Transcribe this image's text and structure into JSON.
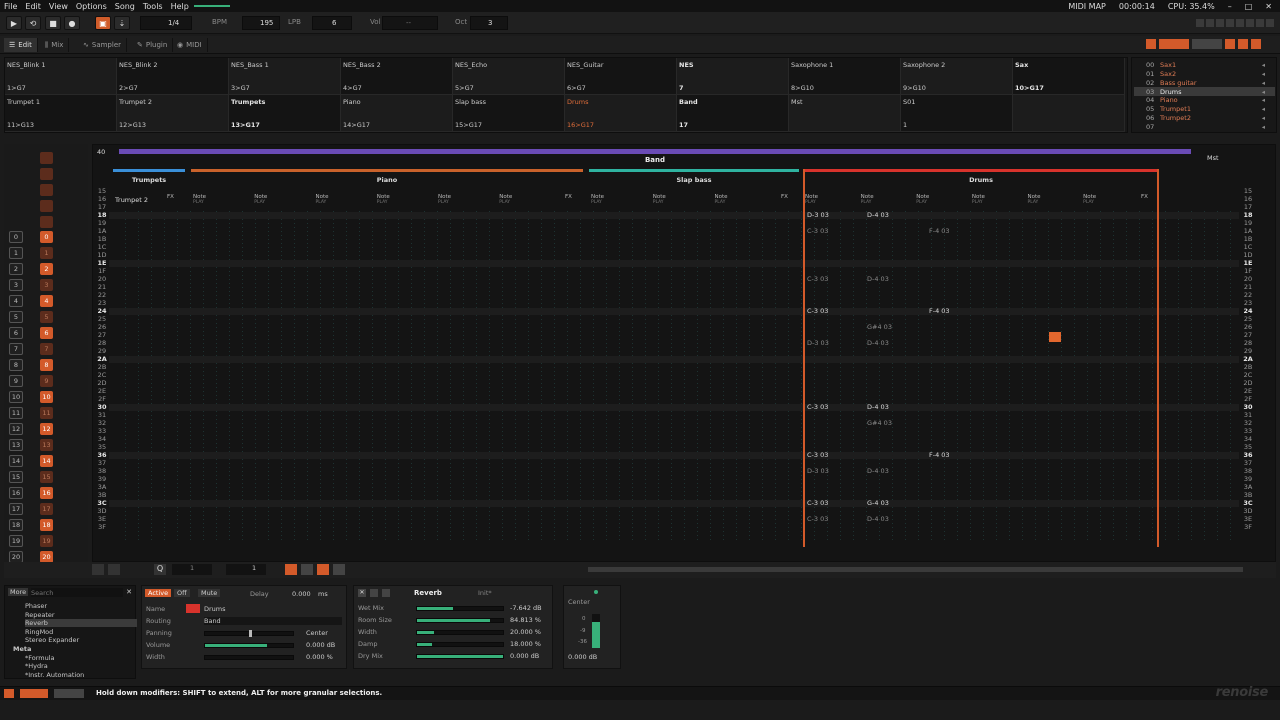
{
  "menu": {
    "items": [
      "File",
      "Edit",
      "View",
      "Options",
      "Song",
      "Tools",
      "Help"
    ],
    "midi_map": "MIDI MAP",
    "time": "00:00:14",
    "cpu": "CPU: 35.4%"
  },
  "toolbar": {
    "play_label": "▶",
    "loop_label": "⟲",
    "stop_label": "■",
    "record_label": "●",
    "edit_step_value": "1/4",
    "bpm_label": "BPM",
    "bpm_value": "195",
    "lpb_label": "LPB",
    "lpb_value": "6",
    "vol_label": "Vol",
    "oct_label": "Oct",
    "oct_value": "3"
  },
  "tabs": [
    {
      "label": "Edit",
      "active": true
    },
    {
      "label": "Mix",
      "active": false
    },
    {
      "label": "Sampler",
      "active": false
    },
    {
      "label": "Plugin",
      "active": false
    },
    {
      "label": "MIDI",
      "active": false
    }
  ],
  "sequence": {
    "row1": [
      {
        "name": "NES_Blink 1",
        "map": "1>G7"
      },
      {
        "name": "NES_Blink 2",
        "map": "2>G7"
      },
      {
        "name": "NES_Bass 1",
        "map": "3>G7"
      },
      {
        "name": "NES_Bass 2",
        "map": "4>G7"
      },
      {
        "name": "NES_Echo",
        "map": "5>G7"
      },
      {
        "name": "NES_Guitar",
        "map": "6>G7"
      },
      {
        "name": "NES",
        "map": "7",
        "bold": true
      },
      {
        "name": "Saxophone 1",
        "map": "8>G10"
      },
      {
        "name": "Saxophone 2",
        "map": "9>G10"
      },
      {
        "name": "Sax",
        "map": "10>G17",
        "bold": true
      }
    ],
    "row2": [
      {
        "name": "Trumpet 1",
        "map": "11>G13"
      },
      {
        "name": "Trumpet 2",
        "map": "12>G13"
      },
      {
        "name": "Trumpets",
        "map": "13>G17",
        "bold": true
      },
      {
        "name": "Piano",
        "map": "14>G17"
      },
      {
        "name": "Slap bass",
        "map": "15>G17"
      },
      {
        "name": "Drums",
        "map": "16>G17",
        "red": true
      },
      {
        "name": "Band",
        "map": "17",
        "bold": true
      },
      {
        "name": "Mst",
        "map": ""
      },
      {
        "name": "S01",
        "map": "1"
      },
      {
        "name": "",
        "map": ""
      }
    ]
  },
  "instruments": [
    {
      "no": "00",
      "name": "Sax1"
    },
    {
      "no": "01",
      "name": "Sax2"
    },
    {
      "no": "02",
      "name": "Bass guitar"
    },
    {
      "no": "03",
      "name": "Drums",
      "selected": true
    },
    {
      "no": "04",
      "name": "Piano"
    },
    {
      "no": "05",
      "name": "Trumpet1"
    },
    {
      "no": "06",
      "name": "Trumpet2"
    },
    {
      "no": "07",
      "name": ""
    }
  ],
  "pattern": {
    "pattern_number": "40",
    "group_name": "Band",
    "tracks": [
      {
        "name": "Trumpets",
        "color": "#3a8fd8"
      },
      {
        "name": "Piano",
        "color": "#c9622b"
      },
      {
        "name": "Slap bass",
        "color": "#2fb3a0"
      },
      {
        "name": "Drums",
        "color": "#d8332c"
      }
    ],
    "sub_track": "Trumpet 2",
    "fx_label": "FX",
    "note_label": "Note",
    "play_label": "PLAY",
    "master_label": "Mst",
    "rows": [
      "15",
      "16",
      "17",
      "18",
      "19",
      "1A",
      "1B",
      "1C",
      "1D",
      "1E",
      "1F",
      "20",
      "21",
      "22",
      "23",
      "24",
      "25",
      "26",
      "27",
      "28",
      "29",
      "2A",
      "2B",
      "2C",
      "2D",
      "2E",
      "2F",
      "30",
      "31",
      "32",
      "33",
      "34",
      "35",
      "36",
      "37",
      "38",
      "39",
      "3A",
      "3B",
      "3C",
      "3D",
      "3E",
      "3F"
    ],
    "highlight_rows": [
      "18",
      "1E",
      "24",
      "2A",
      "30",
      "36",
      "3C"
    ],
    "notes": [
      {
        "row": "18",
        "col": 0,
        "text": "D-3 03"
      },
      {
        "row": "18",
        "col": 1,
        "text": "D-4 03"
      },
      {
        "row": "1A",
        "col": 0,
        "text": "C-3 03",
        "dim": true
      },
      {
        "row": "1A",
        "col": 2,
        "text": "F-4 03",
        "dim": true
      },
      {
        "row": "20",
        "col": 0,
        "text": "C-3 03",
        "dim": true
      },
      {
        "row": "20",
        "col": 1,
        "text": "D-4 03",
        "dim": true
      },
      {
        "row": "24",
        "col": 0,
        "text": "C-3 03"
      },
      {
        "row": "24",
        "col": 2,
        "text": "F-4 03"
      },
      {
        "row": "26",
        "col": 1,
        "text": "G#4 03",
        "dim": true
      },
      {
        "row": "28",
        "col": 0,
        "text": "D-3 03",
        "dim": true
      },
      {
        "row": "28",
        "col": 1,
        "text": "D-4 03",
        "dim": true
      },
      {
        "row": "30",
        "col": 0,
        "text": "C-3 03"
      },
      {
        "row": "30",
        "col": 1,
        "text": "D-4 03"
      },
      {
        "row": "32",
        "col": 1,
        "text": "G#4 03",
        "dim": true
      },
      {
        "row": "36",
        "col": 0,
        "text": "C-3 03"
      },
      {
        "row": "36",
        "col": 2,
        "text": "F-4 03"
      },
      {
        "row": "38",
        "col": 0,
        "text": "D-3 03",
        "dim": true
      },
      {
        "row": "38",
        "col": 1,
        "text": "D-4 03",
        "dim": true
      },
      {
        "row": "3C",
        "col": 0,
        "text": "C-3 03"
      },
      {
        "row": "3C",
        "col": 1,
        "text": "G-4 03"
      },
      {
        "row": "3E",
        "col": 0,
        "text": "C-3 03",
        "dim": true
      },
      {
        "row": "3E",
        "col": 1,
        "text": "D-4 03",
        "dim": true
      }
    ]
  },
  "left_numbers": [
    "0",
    "1",
    "2",
    "3",
    "4",
    "5",
    "6",
    "7",
    "8",
    "9",
    "10",
    "11",
    "12",
    "13",
    "14",
    "15",
    "16",
    "17",
    "18",
    "19",
    "20"
  ],
  "pattern_bottom": {
    "octave_value": "1",
    "step_value": "1"
  },
  "browser": {
    "more_label": "More",
    "search_placeholder": "Search",
    "items": [
      "Phaser",
      "Repeater",
      "Reverb",
      "RingMod",
      "Stereo Expander",
      "Meta",
      "*Formula",
      "*Hydra",
      "*Instr. Automation"
    ]
  },
  "track_dsp": {
    "active_label": "Active",
    "off_label": "Off",
    "mute_label": "Mute",
    "delay_label": "Delay",
    "delay_value": "0.000",
    "delay_unit": "ms",
    "name_label": "Name",
    "name_value": "Drums",
    "routing_label": "Routing",
    "routing_value": "Band",
    "panning_label": "Panning",
    "panning_value": "Center",
    "panning_level": 0.5,
    "volume_label": "Volume",
    "volume_value": "0.000 dB",
    "volume_level": 0.7,
    "width_label": "Width",
    "width_value": "0.000 %",
    "width_level": 0.0
  },
  "reverb": {
    "title": "Reverb",
    "preset": "Init*",
    "params": [
      {
        "label": "Wet Mix",
        "value": "-7.642 dB",
        "level": 0.42
      },
      {
        "label": "Room Size",
        "value": "84.813 %",
        "level": 0.85
      },
      {
        "label": "Width",
        "value": "20.000 %",
        "level": 0.2
      },
      {
        "label": "Damp",
        "value": "18.000 %",
        "level": 0.18
      },
      {
        "label": "Dry Mix",
        "value": "0.000 dB",
        "level": 1.0
      }
    ]
  },
  "meter": {
    "label": "Center",
    "ticks": [
      "0",
      "-9",
      "-36"
    ],
    "value": "0.000 dB"
  },
  "status": {
    "message": "Hold down modifiers: SHIFT to extend, ALT for more granular selections."
  },
  "logo": "renoise",
  "colors": {
    "accent": "#d35a2a",
    "group": "#6a4bb5",
    "piano": "#c9622b",
    "slap": "#2fb3a0",
    "drums": "#d8332c",
    "trumpets": "#3a8fd8",
    "green": "#38b07a"
  }
}
